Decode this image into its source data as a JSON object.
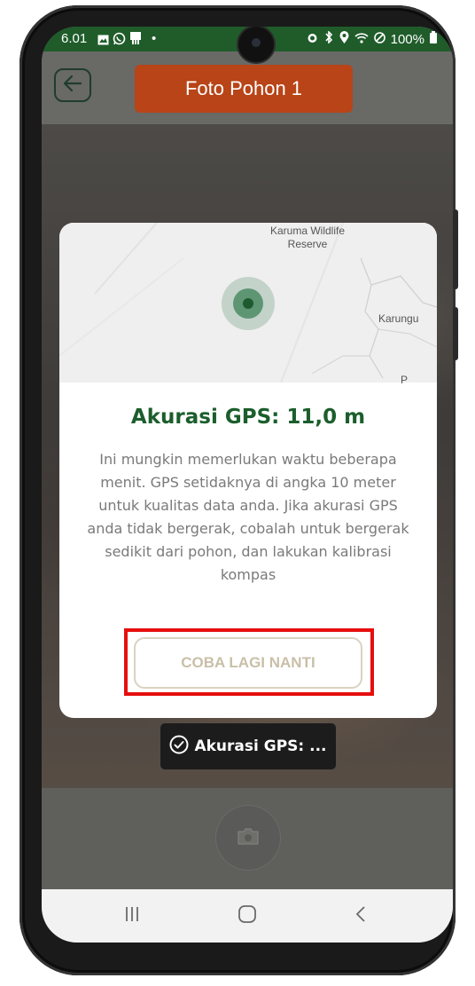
{
  "status_bar": {
    "time": "6.01",
    "dot": "•",
    "battery": "100%",
    "left_icons": [
      "image-icon",
      "whatsapp-icon",
      "sim-icon"
    ],
    "right_icons": [
      "alarm-icon",
      "bluetooth-icon",
      "location-icon",
      "wifi-icon",
      "dnd-icon",
      "battery-icon"
    ]
  },
  "header": {
    "title": "Foto Pohon 1",
    "back_icon": "arrow-left-icon"
  },
  "map": {
    "place_1": "Karuma Wildlife\nReserve",
    "place_2": "Karungu",
    "place_3": "P"
  },
  "dialog": {
    "title": "Akurasi GPS: 11,0 m",
    "body": "Ini mungkin memerlukan waktu beberapa menit. GPS setidaknya di angka 10 meter untuk kualitas data anda. Jika akurasi GPS anda tidak bergerak, cobalah untuk bergerak sedikit dari pohon, dan lakukan kalibrasi kompas",
    "retry_button": "COBA LAGI NANTI"
  },
  "toast": {
    "text": "Akurasi GPS: ...",
    "icon": "check-circle-icon"
  },
  "camera": {
    "shutter_icon": "camera-icon"
  },
  "nav": {
    "recents_icon": "recents-icon",
    "home_icon": "home-icon",
    "back_icon": "back-chevron-icon"
  },
  "colors": {
    "status_bar": "#1f5c2a",
    "title_pill": "#b84417",
    "dialog_title": "#1b5e2c",
    "highlight": "#e60e0e"
  }
}
